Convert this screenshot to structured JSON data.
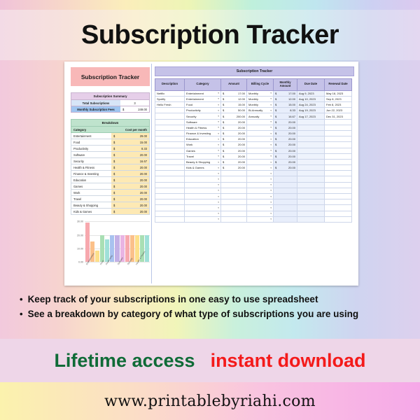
{
  "header": {
    "title": "Subscription Tracker"
  },
  "spreadsheet": {
    "left": {
      "banner": "Subscription Tracker",
      "summary": {
        "heading": "Subscription Summary",
        "rows": [
          {
            "label": "Total Subscriptions",
            "value": "3",
            "currency": ""
          },
          {
            "label": "Monthly Subscription Fees",
            "value": "249.00",
            "currency": "$"
          }
        ]
      },
      "breakdown": {
        "heading": "Breakdown",
        "columns": [
          "Category",
          "Cost per month"
        ],
        "currency": "$",
        "rows": [
          {
            "category": "Entertainment",
            "cost": "29.00"
          },
          {
            "category": "Food",
            "cost": "15.00"
          },
          {
            "category": "Productivity",
            "cost": "8.33"
          },
          {
            "category": "Software",
            "cost": "20.00"
          },
          {
            "category": "Security",
            "cost": "16.67"
          },
          {
            "category": "Health & Fitness",
            "cost": "20.00"
          },
          {
            "category": "Finance & Investing",
            "cost": "20.00"
          },
          {
            "category": "Education",
            "cost": "20.00"
          },
          {
            "category": "Games",
            "cost": "20.00"
          },
          {
            "category": "Work",
            "cost": "20.00"
          },
          {
            "category": "Travel",
            "cost": "20.00"
          },
          {
            "category": "Beauty & Shopping",
            "cost": "20.00"
          },
          {
            "category": "Kids & Games",
            "cost": "20.00"
          }
        ]
      }
    },
    "right": {
      "banner": "Subscription Tracker",
      "columns": [
        "Description",
        "Category",
        "Amount",
        "Billing Cycle",
        "Monthly Amount",
        "Due Date",
        "Renewal Date"
      ],
      "currency": "$",
      "caret": "▾",
      "rows": [
        {
          "description": "Netflix",
          "category": "Entertainment",
          "amount": "17.00",
          "cycle": "Monthly",
          "monthly": "17.00",
          "due": "Aug 9, 2023",
          "renewal": "May 18, 2023"
        },
        {
          "description": "Spotify",
          "category": "Entertainment",
          "amount": "12.00",
          "cycle": "Monthly",
          "monthly": "12.00",
          "due": "Aug 10, 2023",
          "renewal": "Sep 8, 2023"
        },
        {
          "description": "Hello Fresh",
          "category": "Food",
          "amount": "15.00",
          "cycle": "Monthly",
          "monthly": "15.00",
          "due": "Aug 24, 2023",
          "renewal": "Feb 8, 2023"
        },
        {
          "description": "",
          "category": "Productivity",
          "amount": "50.00",
          "cycle": "Bi-Annually",
          "monthly": "8.33",
          "due": "Aug 19, 2023",
          "renewal": "Jun 22, 2023"
        },
        {
          "description": "",
          "category": "Security",
          "amount": "200.00",
          "cycle": "Annually",
          "monthly": "16.67",
          "due": "Aug 17, 2023",
          "renewal": "Dec 31, 2023"
        },
        {
          "description": "",
          "category": "Software",
          "amount": "20.00",
          "cycle": "",
          "monthly": "20.00",
          "due": "",
          "renewal": ""
        },
        {
          "description": "",
          "category": "Health & Fitness",
          "amount": "20.00",
          "cycle": "",
          "monthly": "20.00",
          "due": "",
          "renewal": ""
        },
        {
          "description": "",
          "category": "Finance & Investing",
          "amount": "20.00",
          "cycle": "",
          "monthly": "20.00",
          "due": "",
          "renewal": ""
        },
        {
          "description": "",
          "category": "Education",
          "amount": "20.00",
          "cycle": "",
          "monthly": "20.00",
          "due": "",
          "renewal": ""
        },
        {
          "description": "",
          "category": "Work",
          "amount": "20.00",
          "cycle": "",
          "monthly": "20.00",
          "due": "",
          "renewal": ""
        },
        {
          "description": "",
          "category": "Games",
          "amount": "20.00",
          "cycle": "",
          "monthly": "20.00",
          "due": "",
          "renewal": ""
        },
        {
          "description": "",
          "category": "Travel",
          "amount": "20.00",
          "cycle": "",
          "monthly": "20.00",
          "due": "",
          "renewal": ""
        },
        {
          "description": "",
          "category": "Beauty & Shopping",
          "amount": "20.00",
          "cycle": "",
          "monthly": "20.00",
          "due": "",
          "renewal": ""
        },
        {
          "description": "",
          "category": "Kids & Games",
          "amount": "20.00",
          "cycle": "",
          "monthly": "20.00",
          "due": "",
          "renewal": ""
        },
        {
          "description": "",
          "category": "",
          "amount": "",
          "cycle": "",
          "monthly": "",
          "due": "",
          "renewal": ""
        },
        {
          "description": "",
          "category": "",
          "amount": "",
          "cycle": "",
          "monthly": "",
          "due": "",
          "renewal": ""
        },
        {
          "description": "",
          "category": "",
          "amount": "",
          "cycle": "",
          "monthly": "",
          "due": "",
          "renewal": ""
        },
        {
          "description": "",
          "category": "",
          "amount": "",
          "cycle": "",
          "monthly": "",
          "due": "",
          "renewal": ""
        },
        {
          "description": "",
          "category": "",
          "amount": "",
          "cycle": "",
          "monthly": "",
          "due": "",
          "renewal": ""
        },
        {
          "description": "",
          "category": "",
          "amount": "",
          "cycle": "",
          "monthly": "",
          "due": "",
          "renewal": ""
        },
        {
          "description": "",
          "category": "",
          "amount": "",
          "cycle": "",
          "monthly": "",
          "due": "",
          "renewal": ""
        },
        {
          "description": "",
          "category": "",
          "amount": "",
          "cycle": "",
          "monthly": "",
          "due": "",
          "renewal": ""
        },
        {
          "description": "",
          "category": "",
          "amount": "",
          "cycle": "",
          "monthly": "",
          "due": "",
          "renewal": ""
        }
      ]
    }
  },
  "chart_data": {
    "type": "bar",
    "title": "",
    "xlabel": "",
    "ylabel": "",
    "ylim": [
      0,
      30
    ],
    "yticks": [
      "0.00",
      "10.00",
      "20.00",
      "30.00"
    ],
    "grid": true,
    "legend": "none",
    "categories": [
      "Entertainment",
      "Food",
      "Productivity",
      "Software",
      "Security",
      "Health & Fitness",
      "Finance & Investing",
      "Education",
      "Games",
      "Work",
      "Travel",
      "Beauty & Shopping",
      "Kids & Games"
    ],
    "values": [
      29.0,
      15.0,
      8.33,
      20.0,
      16.67,
      20.0,
      20.0,
      20.0,
      20.0,
      20.0,
      20.0,
      20.0,
      20.0
    ],
    "colors": [
      "#f7a8ae",
      "#fbc08a",
      "#fde08a",
      "#a9dfb4",
      "#9fe0d8",
      "#a8c2ef",
      "#c3b0e6",
      "#e9b4e3",
      "#f7a8ae",
      "#fbc08a",
      "#fde08a",
      "#a9dfb4",
      "#9fe0d8"
    ]
  },
  "bullets": [
    {
      "marker": "•",
      "text": "Keep track of your subscriptions in one easy to use spreadsheet"
    },
    {
      "marker": "•",
      "text": "See a breakdown by category of what type of subscriptions you are using"
    }
  ],
  "promo": {
    "lifetime": "Lifetime access",
    "instant": "instant download",
    "lifetime_color": "#0f6b37",
    "instant_color": "#f41a1a"
  },
  "footer": {
    "url": "www.printablebyriahi.com"
  }
}
